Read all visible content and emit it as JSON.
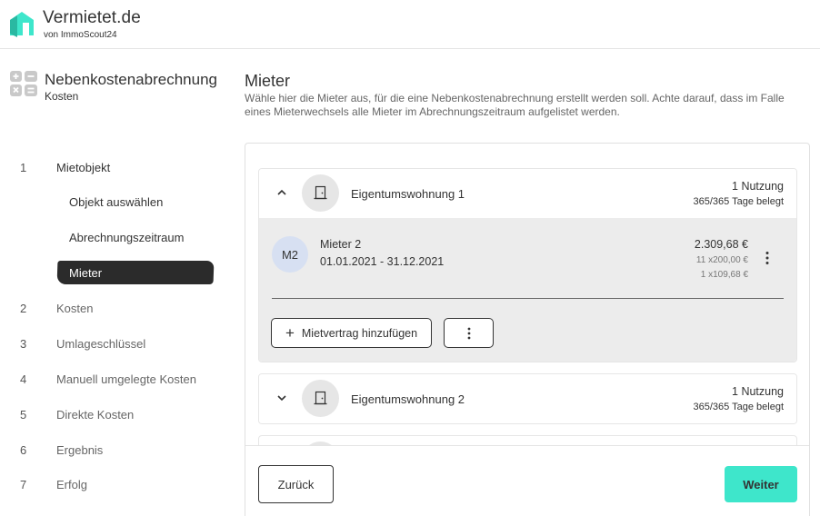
{
  "header": {
    "brand": "Vermietet.de",
    "brand_sub": "von ImmoScout24",
    "logo_icon": "house-logo-icon",
    "accent": "#3ee6cb"
  },
  "sidebar": {
    "title": "Nebenkostenabrechnung",
    "subtitle": "Kosten",
    "icon": "calculator-icon",
    "steps": [
      {
        "num": "1",
        "label": "Mietobjekt"
      },
      {
        "num": "2",
        "label": "Kosten"
      },
      {
        "num": "3",
        "label": "Umlageschlüssel"
      },
      {
        "num": "4",
        "label": "Manuell umgelegte Kosten"
      },
      {
        "num": "5",
        "label": "Direkte Kosten"
      },
      {
        "num": "6",
        "label": "Ergebnis"
      },
      {
        "num": "7",
        "label": "Erfolg"
      }
    ],
    "substeps": [
      {
        "label": "Objekt auswählen"
      },
      {
        "label": "Abrechnungszeitraum"
      },
      {
        "label": "Mieter",
        "active": true
      }
    ]
  },
  "main": {
    "title": "Mieter",
    "description": "Wähle hier die Mieter aus, für die eine Nebenkostenabrechnung erstellt werden soll. Achte darauf, dass im Falle eines Mieterwechsels alle Mieter im Abrechnungszeitraum aufgelistet werden.",
    "units": [
      {
        "name": "Eigentumswohnung 1",
        "usage": "1 Nutzung",
        "days": "365/365 Tage belegt",
        "expanded": true,
        "tenants": [
          {
            "initials": "M2",
            "name": "Mieter 2",
            "period": "01.01.2021 - 31.12.2021",
            "total": "2.309,68 €",
            "lines": [
              "11 x200,00 €",
              "1 x109,68 €"
            ]
          }
        ],
        "add_contract_label": "Mietvertrag hinzufügen"
      },
      {
        "name": "Eigentumswohnung 2",
        "usage": "1 Nutzung",
        "days": "365/365 Tage belegt",
        "expanded": false
      }
    ],
    "back_label": "Zurück",
    "next_label": "Weiter"
  }
}
